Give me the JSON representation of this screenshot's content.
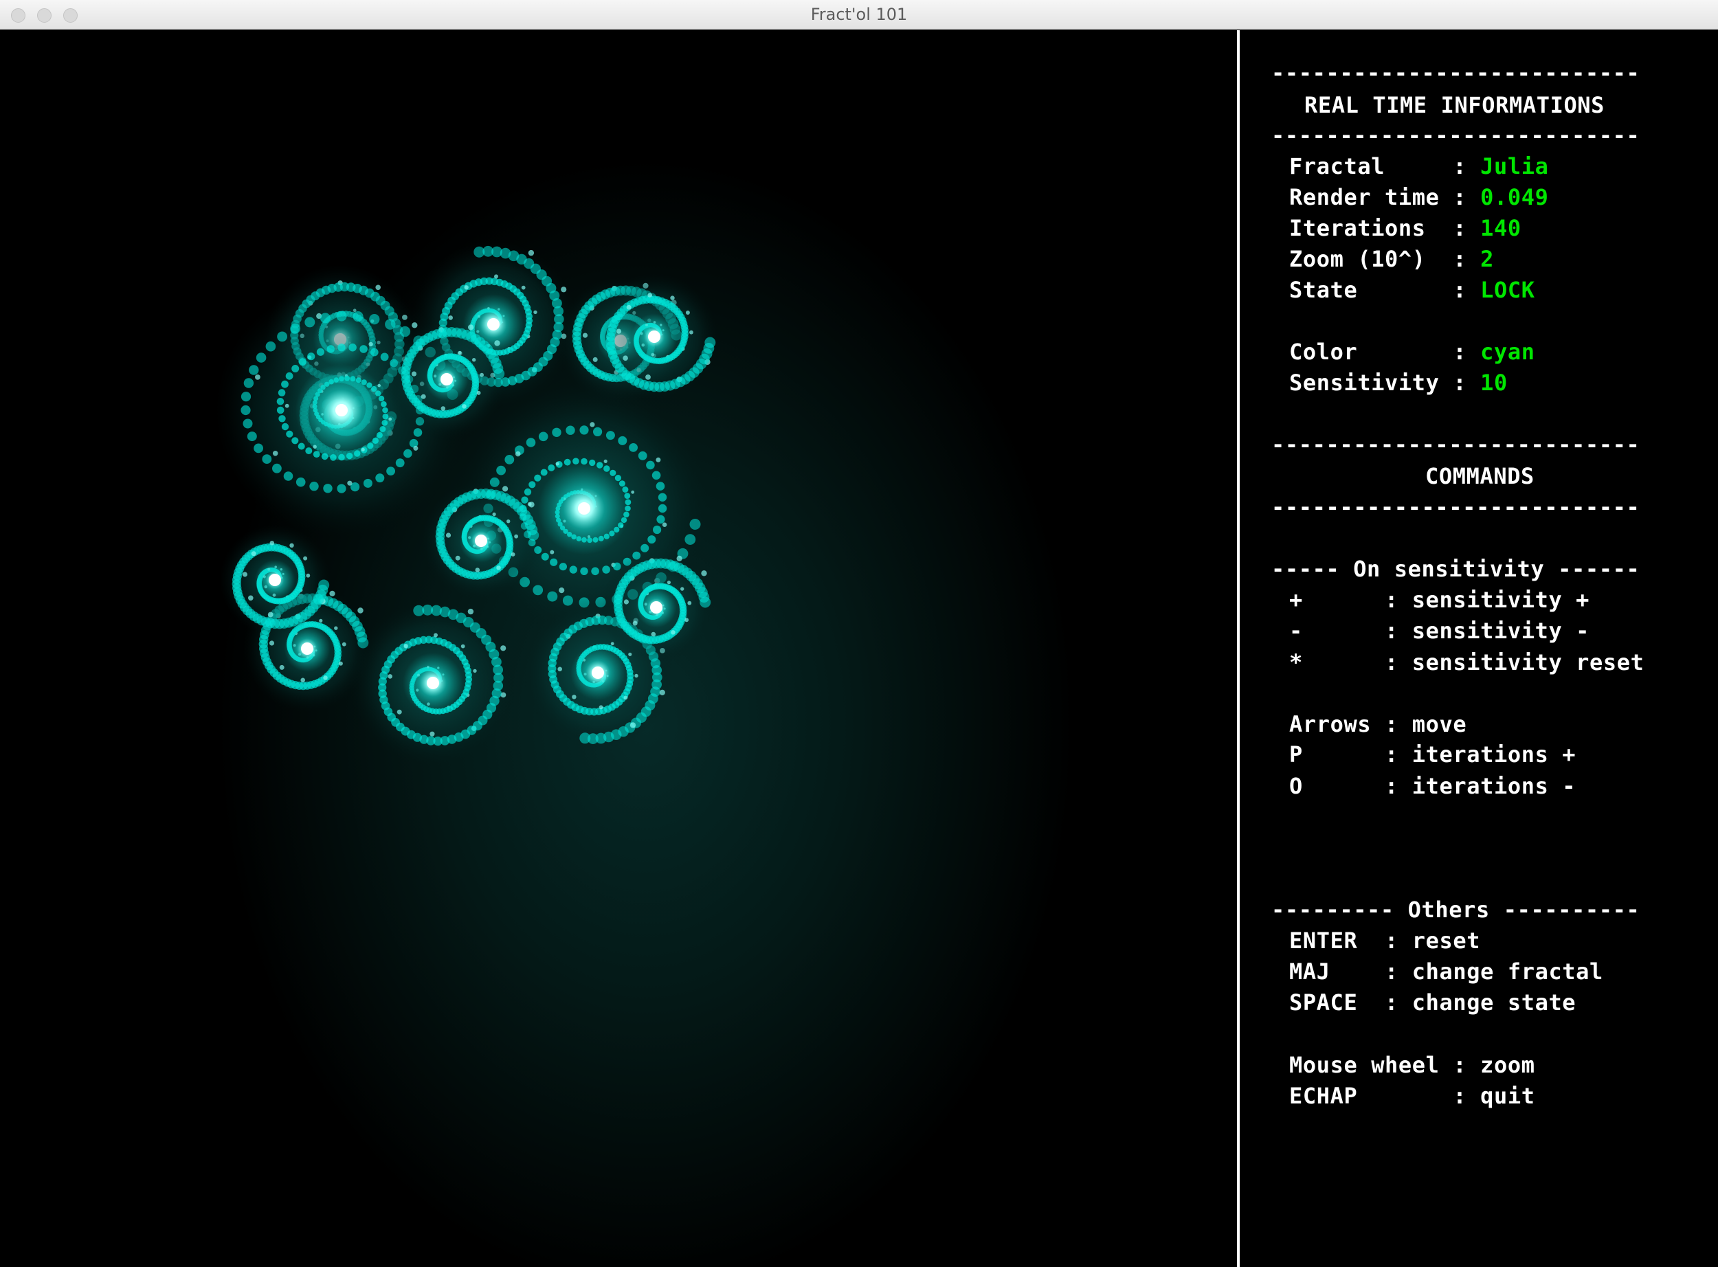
{
  "window": {
    "title": "Fract'ol 101"
  },
  "panel": {
    "sep": "---------------------------",
    "info_header": "REAL TIME INFORMATIONS",
    "info": [
      {
        "label": "Fractal     : ",
        "value": "Julia"
      },
      {
        "label": "Render time : ",
        "value": "0.049"
      },
      {
        "label": "Iterations  : ",
        "value": "140"
      },
      {
        "label": "Zoom (10^)  : ",
        "value": "2"
      },
      {
        "label": "State       : ",
        "value": "LOCK"
      },
      {
        "label": "Color       : ",
        "value": "cyan"
      },
      {
        "label": "Sensitivity : ",
        "value": "10"
      }
    ],
    "commands_header": "COMMANDS",
    "sensitivity_header": "----- On sensitivity ------",
    "sensitivity_cmds": [
      "+      : sensitivity +",
      "-      : sensitivity -",
      "*      : sensitivity reset"
    ],
    "move_cmds": [
      "Arrows : move",
      "P      : iterations +",
      "O      : iterations -"
    ],
    "others_header": "--------- Others ----------",
    "others_cmds": [
      "ENTER  : reset",
      "MAJ    : change fractal",
      "SPACE  : change state"
    ],
    "misc_cmds": [
      "Mouse wheel : zoom",
      "ECHAP       : quit"
    ]
  },
  "colors": {
    "value_green": "#00e600",
    "fractal_cyan": "#00e5d8",
    "background": "#000000"
  }
}
